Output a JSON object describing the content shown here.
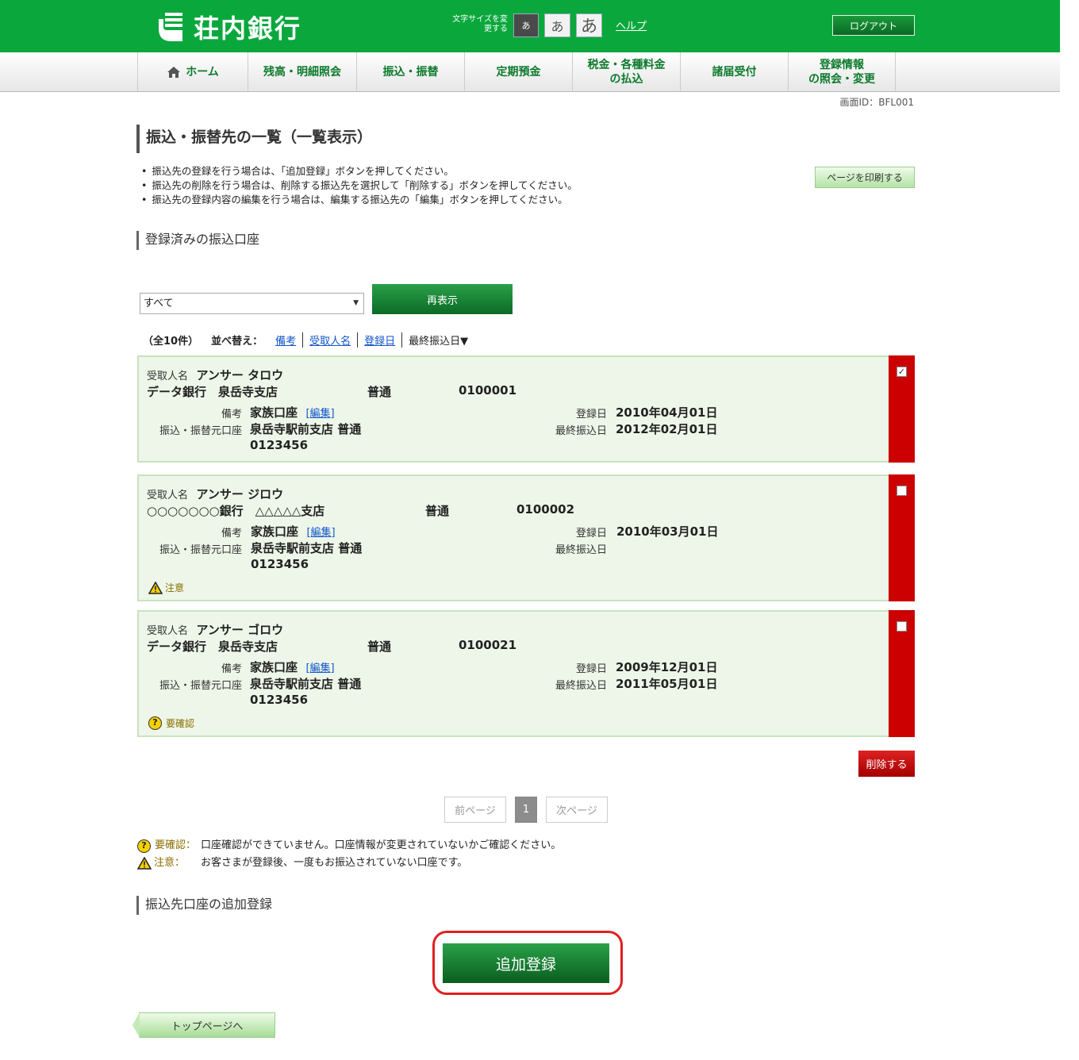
{
  "header": {
    "bank_name": "荘内銀行",
    "font_size_label": "文字サイズを変更する",
    "font_small": "あ",
    "font_medium": "あ",
    "font_large": "あ",
    "help": "ヘルプ",
    "logout": "ログアウト"
  },
  "nav": {
    "home": "ホーム",
    "balance": "残高・明細照会",
    "transfer": "振込・振替",
    "time_deposit": "定期預金",
    "tax_line1": "税金・各種料金",
    "tax_line2": "の払込",
    "procedures": "諸届受付",
    "reg_line1": "登録情報",
    "reg_line2": "の照会・変更"
  },
  "screen_id": "画面ID：BFL001",
  "page_title": "振込・振替先の一覧（一覧表示）",
  "instructions": [
    "振込先の登録を行う場合は、「追加登録」ボタンを押してください。",
    "振込先の削除を行う場合は、削除する振込先を選択して「削除する」ボタンを押してください。",
    "振込先の登録内容の編集を行う場合は、編集する振込先の「編集」ボタンを押してください。"
  ],
  "print_button": "ページを印刷する",
  "registered_section_title": "登録済みの振込口座",
  "filter": {
    "selected": "すべて",
    "redisplay": "再表示"
  },
  "sort": {
    "count": "（全10件）",
    "label": "並べ替え：",
    "option_note": "備考",
    "option_recipient": "受取人名",
    "option_reg_date": "登録日",
    "current": "最終振込日▼"
  },
  "labels": {
    "recipient": "受取人名",
    "note": "備考",
    "source": "振込・振替元口座",
    "reg_date": "登録日",
    "last_transfer": "最終振込日",
    "edit": "[編集]"
  },
  "accounts": [
    {
      "recipient": "アンサー タロウ",
      "bank_branch": "データ銀行　泉岳寺支店",
      "type": "普通",
      "number": "0100001",
      "note": "家族口座",
      "source": "泉岳寺駅前支店 普通",
      "source_number": "0123456",
      "reg_date": "2010年04月01日",
      "last_transfer": "2012年02月01日",
      "checked": true,
      "status": ""
    },
    {
      "recipient": "アンサー ジロウ",
      "bank_branch": "○○○○○○○銀行　△△△△△支店",
      "type": "普通",
      "number": "0100002",
      "note": "家族口座",
      "source": "泉岳寺駅前支店 普通",
      "source_number": "0123456",
      "reg_date": "2010年03月01日",
      "last_transfer": "",
      "checked": false,
      "status": "注意"
    },
    {
      "recipient": "アンサー ゴロウ",
      "bank_branch": "データ銀行　泉岳寺支店",
      "type": "普通",
      "number": "0100021",
      "note": "家族口座",
      "source": "泉岳寺駅前支店 普通",
      "source_number": "0123456",
      "reg_date": "2009年12月01日",
      "last_transfer": "2011年05月01日",
      "checked": false,
      "status": "要確認"
    }
  ],
  "delete_button": "削除する",
  "pager": {
    "prev": "前ページ",
    "current": "1",
    "next": "次ページ"
  },
  "legend": {
    "confirm_key": "要確認：",
    "confirm_text": "口座確認ができていません。口座情報が変更されていないかご確認ください。",
    "caution_key": "注意：",
    "caution_text": "お客さまが登録後、一度もお振込されていない口座です。"
  },
  "add_section_title": "振込先口座の追加登録",
  "add_button": "追加登録",
  "top_page_button": "トップページへ",
  "colors": {
    "brand_green": "#0aa83c",
    "delete_red": "#cc0000",
    "card_bg": "#edf6e8"
  }
}
